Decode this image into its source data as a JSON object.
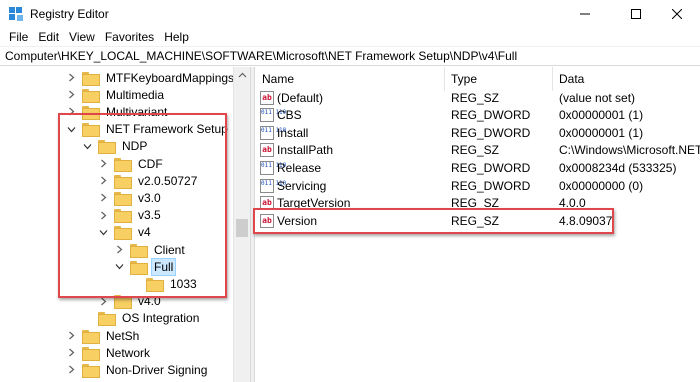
{
  "window": {
    "title": "Registry Editor"
  },
  "menu": [
    "File",
    "Edit",
    "View",
    "Favorites",
    "Help"
  ],
  "address": "Computer\\HKEY_LOCAL_MACHINE\\SOFTWARE\\Microsoft\\NET Framework Setup\\NDP\\v4\\Full",
  "tree": [
    {
      "label": "MTFKeyboardMappings",
      "twisty": "collapsed"
    },
    {
      "label": "Multimedia",
      "twisty": "collapsed"
    },
    {
      "label": "Multivariant",
      "twisty": "collapsed"
    },
    {
      "label": "NET Framework Setup",
      "twisty": "expanded"
    },
    {
      "label": "NDP",
      "twisty": "expanded"
    },
    {
      "label": "CDF",
      "twisty": "collapsed"
    },
    {
      "label": "v2.0.50727",
      "twisty": "collapsed"
    },
    {
      "label": "v3.0",
      "twisty": "collapsed"
    },
    {
      "label": "v3.5",
      "twisty": "collapsed"
    },
    {
      "label": "v4",
      "twisty": "expanded"
    },
    {
      "label": "Client",
      "twisty": "collapsed"
    },
    {
      "label": "Full",
      "twisty": "expanded",
      "selected": true
    },
    {
      "label": "1033",
      "twisty": "none"
    },
    {
      "label": "v4.0",
      "twisty": "collapsed"
    },
    {
      "label": "OS Integration",
      "twisty": "none"
    },
    {
      "label": "NetSh",
      "twisty": "collapsed"
    },
    {
      "label": "Network",
      "twisty": "collapsed"
    },
    {
      "label": "Non-Driver Signing",
      "twisty": "collapsed"
    }
  ],
  "columns": {
    "name": "Name",
    "type": "Type",
    "data": "Data"
  },
  "values": [
    {
      "icon": "string-value-icon",
      "icon_text": "ab",
      "name": "(Default)",
      "type": "REG_SZ",
      "data": "(value not set)"
    },
    {
      "icon": "dword-value-icon",
      "icon_text": "011 110",
      "name": "CBS",
      "type": "REG_DWORD",
      "data": "0x00000001 (1)"
    },
    {
      "icon": "dword-value-icon",
      "icon_text": "011 110",
      "name": "Install",
      "type": "REG_DWORD",
      "data": "0x00000001 (1)"
    },
    {
      "icon": "string-value-icon",
      "icon_text": "ab",
      "name": "InstallPath",
      "type": "REG_SZ",
      "data": "C:\\Windows\\Microsoft.NET\\"
    },
    {
      "icon": "dword-value-icon",
      "icon_text": "011 110",
      "name": "Release",
      "type": "REG_DWORD",
      "data": "0x0008234d (533325)"
    },
    {
      "icon": "dword-value-icon",
      "icon_text": "011 110",
      "name": "Servicing",
      "type": "REG_DWORD",
      "data": "0x00000000 (0)"
    },
    {
      "icon": "string-value-icon",
      "icon_text": "ab",
      "name": "TargetVersion",
      "type": "REG_SZ",
      "data": "4.0.0"
    },
    {
      "icon": "string-value-icon",
      "icon_text": "ab",
      "name": "Version",
      "type": "REG_SZ",
      "data": "4.8.09037"
    }
  ],
  "colors": {
    "highlight": "#e0474c",
    "selection": "#cce8ff",
    "folder": "#f7cf62"
  }
}
